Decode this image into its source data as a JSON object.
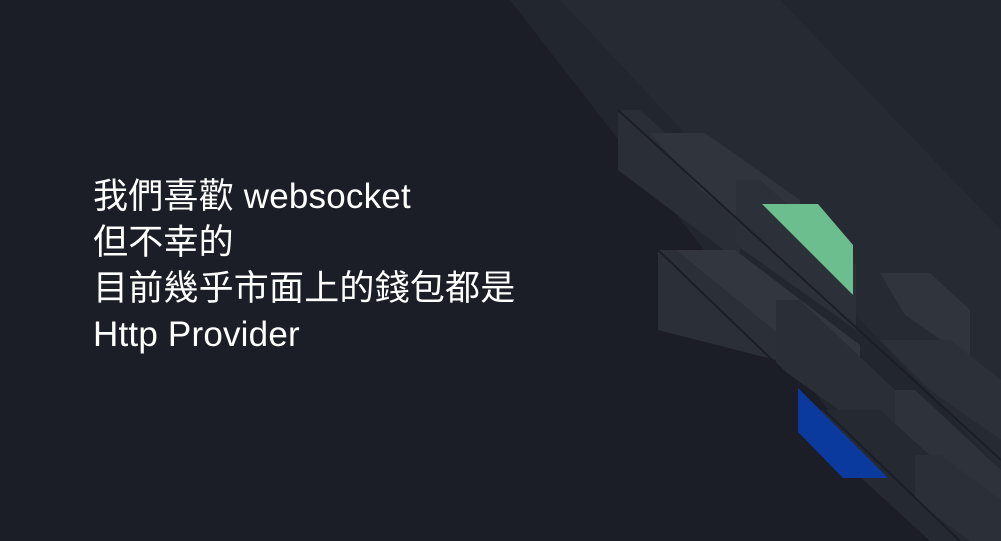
{
  "slide": {
    "lines": [
      "我們喜歡 websocket",
      "但不幸的",
      "目前幾乎市面上的錢包都是",
      "Http Provider"
    ]
  },
  "theme": {
    "background": "#1b1e27",
    "text_color": "#ffffff",
    "accent_green": "#6dbe8f",
    "accent_blue": "#0b3a9e",
    "shape_dark": "#23272f",
    "shape_mid": "#2b2f38"
  }
}
